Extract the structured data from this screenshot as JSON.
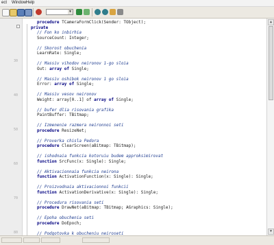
{
  "menubar": {
    "items": [
      "ect",
      "Window",
      "Help"
    ]
  },
  "toolbar": {
    "icons": [
      "new-file-icon",
      "open-file-icon",
      "save-icon",
      "save-all-icon",
      "cut-icon",
      "copy-icon",
      "paste-icon",
      "undo-icon",
      "redo-icon",
      "stop-icon",
      "run-icon",
      "step-icon",
      "back-icon",
      "forward-icon",
      "build-icon",
      "debug-icon"
    ],
    "accent_colors": {
      "stop": "#c0392b",
      "run": "#2e8b3d",
      "nav": "#2f7d8c"
    }
  },
  "gutter": {
    "line_numbers": [
      "30",
      "40",
      "50",
      "60",
      "70",
      "80"
    ]
  },
  "code": {
    "lines": [
      {
        "indent": 2,
        "parts": [
          [
            "kw",
            "procedure "
          ],
          [
            "tx",
            "TCameraFormClick(Sender: TObject);"
          ]
        ]
      },
      {
        "indent": 1,
        "parts": [
          [
            "kw",
            "private"
          ]
        ]
      },
      {
        "indent": 2,
        "parts": [
          [
            "cm",
            "// Fon ko inbirhia"
          ]
        ]
      },
      {
        "indent": 2,
        "parts": [
          [
            "tx",
            "SourceCount: Integer;"
          ]
        ]
      },
      {
        "indent": 0,
        "parts": []
      },
      {
        "indent": 2,
        "parts": [
          [
            "cm",
            "// Skorost obuchenia"
          ]
        ]
      },
      {
        "indent": 2,
        "parts": [
          [
            "tx",
            "LearnRate: Single;"
          ]
        ]
      },
      {
        "indent": 0,
        "parts": []
      },
      {
        "indent": 2,
        "parts": [
          [
            "cm",
            "// Massiv vihodov neironov 1-go sloia"
          ]
        ]
      },
      {
        "indent": 2,
        "parts": [
          [
            "tx",
            "Out: "
          ],
          [
            "kw",
            "array of "
          ],
          [
            "tx",
            "Single;"
          ]
        ]
      },
      {
        "indent": 0,
        "parts": []
      },
      {
        "indent": 2,
        "parts": [
          [
            "cm",
            "// Massiv oshibok neironov 1 go sloia"
          ]
        ]
      },
      {
        "indent": 2,
        "parts": [
          [
            "tx",
            "Error: "
          ],
          [
            "kw",
            "array of "
          ],
          [
            "tx",
            "Single;"
          ]
        ]
      },
      {
        "indent": 0,
        "parts": []
      },
      {
        "indent": 2,
        "parts": [
          [
            "cm",
            "// Massiv vesov neironov"
          ]
        ]
      },
      {
        "indent": 2,
        "parts": [
          [
            "tx",
            "Weight: array[0..1] of "
          ],
          [
            "kw",
            "array of "
          ],
          [
            "tx",
            "Single;"
          ]
        ]
      },
      {
        "indent": 0,
        "parts": []
      },
      {
        "indent": 2,
        "parts": [
          [
            "cm",
            "// bufer dlia risovania grafika"
          ]
        ]
      },
      {
        "indent": 2,
        "parts": [
          [
            "tx",
            "PaintBuffer: TBitmap;"
          ]
        ]
      },
      {
        "indent": 0,
        "parts": []
      },
      {
        "indent": 2,
        "parts": [
          [
            "cm",
            "// Izmenenie razmera neironnoi seti"
          ]
        ]
      },
      {
        "indent": 2,
        "parts": [
          [
            "kw",
            "procedure "
          ],
          [
            "tx",
            "ResizeNet;"
          ]
        ]
      },
      {
        "indent": 0,
        "parts": []
      },
      {
        "indent": 2,
        "parts": [
          [
            "cm",
            "// Proverka chisla Pedora"
          ]
        ]
      },
      {
        "indent": 2,
        "parts": [
          [
            "kw",
            "procedure "
          ],
          [
            "tx",
            "ClearScreen(aBitmap: TBitmap);"
          ]
        ]
      },
      {
        "indent": 0,
        "parts": []
      },
      {
        "indent": 2,
        "parts": [
          [
            "cm",
            "// ishodnaia funkcia kotoruiu budem approksimirovat"
          ]
        ]
      },
      {
        "indent": 2,
        "parts": [
          [
            "kw",
            "function "
          ],
          [
            "tx",
            "SrcFunc(x: Single): Single;"
          ]
        ]
      },
      {
        "indent": 0,
        "parts": []
      },
      {
        "indent": 2,
        "parts": [
          [
            "cm",
            "// Aktivacionnaia funkcia neirona"
          ]
        ]
      },
      {
        "indent": 2,
        "parts": [
          [
            "kw",
            "function "
          ],
          [
            "tx",
            "ActivationFunction(x: Single): Single;"
          ]
        ]
      },
      {
        "indent": 0,
        "parts": []
      },
      {
        "indent": 2,
        "parts": [
          [
            "cm",
            "// Proizvodnaia aktivacionnoi funkcii"
          ]
        ]
      },
      {
        "indent": 2,
        "parts": [
          [
            "kw",
            "function "
          ],
          [
            "tx",
            "ActivationDerivative(x: Single): Single;"
          ]
        ]
      },
      {
        "indent": 0,
        "parts": []
      },
      {
        "indent": 2,
        "parts": [
          [
            "cm",
            "// Procedura risovania seti"
          ]
        ]
      },
      {
        "indent": 2,
        "parts": [
          [
            "kw",
            "procedure "
          ],
          [
            "tx",
            "DrawNet(aBitmap: TBitmap; AGraphics: Single);"
          ]
        ]
      },
      {
        "indent": 0,
        "parts": []
      },
      {
        "indent": 2,
        "parts": [
          [
            "cm",
            "// Epoha obuchenia seti"
          ]
        ]
      },
      {
        "indent": 2,
        "parts": [
          [
            "kw",
            "procedure "
          ],
          [
            "tx",
            "DoEpoch;"
          ]
        ]
      },
      {
        "indent": 0,
        "parts": []
      },
      {
        "indent": 2,
        "parts": [
          [
            "cm",
            "// Podgotovka k obucheniu neiroseti"
          ]
        ]
      }
    ]
  },
  "status": {
    "cells": [
      "",
      "",
      "",
      ""
    ]
  }
}
